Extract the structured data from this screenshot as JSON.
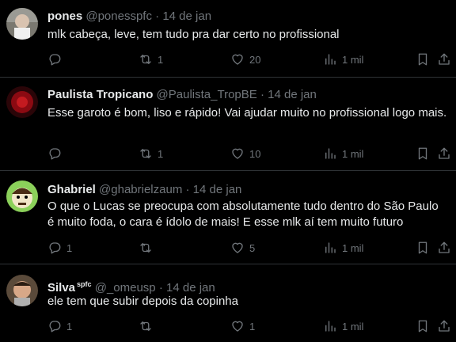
{
  "tweets": [
    {
      "name": "pones",
      "handle": "@ponesspfc",
      "sep": "·",
      "date": "14 de jan",
      "text": "mlk cabeça, leve, tem tudo pra dar certo no profissional",
      "retweets": "1",
      "likes": "20",
      "views": "1 mil"
    },
    {
      "name": "Paulista Tropicano",
      "handle": "@Paulista_TropBE",
      "sep": "·",
      "date": "14 de jan",
      "text": "Esse garoto é bom, liso e rápido! Vai ajudar muito no profissional logo mais.",
      "retweets": "1",
      "likes": "10",
      "views": "1 mil"
    },
    {
      "name": "Ghabriel",
      "handle": "@ghabrielzaum",
      "sep": "·",
      "date": "14 de jan",
      "text": "O que o Lucas se preocupa com absolutamente tudo dentro do São Paulo é muito foda, o cara é ídolo de mais! E esse mlk aí tem muito futuro",
      "replies": "1",
      "likes": "5",
      "views": "1 mil"
    },
    {
      "name": "Silva",
      "badge": "spfc",
      "handle": "@_omeusp",
      "sep": "·",
      "date": "14 de jan",
      "text": "ele tem que subir depois da copinha",
      "replies": "1",
      "likes": "1",
      "views": "1 mil"
    }
  ],
  "icons": {
    "reply": "reply-icon",
    "retweet": "retweet-icon",
    "like": "heart-icon",
    "views": "views-icon",
    "bookmark": "bookmark-icon",
    "share": "share-icon"
  },
  "colors": {
    "background": "#000000",
    "text": "#e7e9ea",
    "muted": "#71767b",
    "divider": "#2f3336"
  }
}
